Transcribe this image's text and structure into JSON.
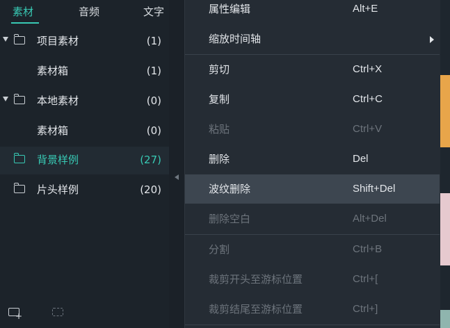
{
  "tabs": [
    {
      "label": "素材",
      "active": true
    },
    {
      "label": "音频",
      "active": false
    },
    {
      "label": "文字",
      "active": false
    }
  ],
  "tree": [
    {
      "label": "项目素材",
      "count": "(1)",
      "expanded": true,
      "icon": "folder-icon"
    },
    {
      "label": "素材箱",
      "count": "(1)"
    },
    {
      "label": "本地素材",
      "count": "(0)",
      "expanded": true,
      "icon": "folder-icon"
    },
    {
      "label": "素材箱",
      "count": "(0)"
    },
    {
      "label": "背景样例",
      "count": "(27)",
      "selected": true,
      "icon": "folder-icon"
    },
    {
      "label": "片头样例",
      "count": "(20)",
      "icon": "folder-icon"
    }
  ],
  "bottom_icons": [
    "new-folder-icon",
    "folder-icon"
  ],
  "menu": [
    {
      "label": "属性编辑",
      "shortcut": "Alt+E",
      "disabled": false
    },
    {
      "label": "缩放时间轴",
      "shortcut": "",
      "submenu": true
    },
    {
      "label": "剪切",
      "shortcut": "Ctrl+X",
      "disabled": false
    },
    {
      "label": "复制",
      "shortcut": "Ctrl+C",
      "disabled": false
    },
    {
      "label": "粘贴",
      "shortcut": "Ctrl+V",
      "disabled": true
    },
    {
      "label": "删除",
      "shortcut": "Del",
      "disabled": false
    },
    {
      "label": "波纹删除",
      "shortcut": "Shift+Del",
      "disabled": false,
      "hover": true
    },
    {
      "label": "删除空白",
      "shortcut": "Alt+Del",
      "disabled": true
    },
    {
      "label": "分割",
      "shortcut": "Ctrl+B",
      "disabled": true
    },
    {
      "label": "裁剪开头至游标位置",
      "shortcut": "Ctrl+[",
      "disabled": true
    },
    {
      "label": "裁剪结尾至游标位置",
      "shortcut": "Ctrl+]",
      "disabled": true
    }
  ],
  "colors": {
    "accent": "#38c9b4",
    "clip_orange": "#e8a54a",
    "clip_pink": "#e6c9cf",
    "clip_teal": "#8fb5ae"
  }
}
